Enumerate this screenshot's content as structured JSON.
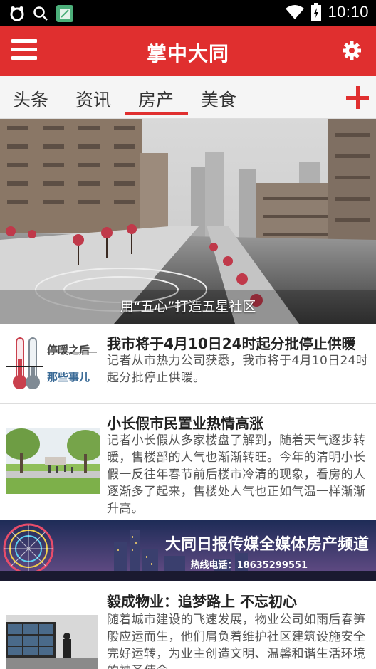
{
  "status_bar": {
    "time": "10:10"
  },
  "header": {
    "title": "掌中大同"
  },
  "tabs": [
    {
      "label": "头条"
    },
    {
      "label": "资讯"
    },
    {
      "label": "房产",
      "active": true
    },
    {
      "label": "美食"
    }
  ],
  "banner": {
    "caption": "用“五心”打造五星社区"
  },
  "news": [
    {
      "title": "我市将于4月10日24时起分批停止供暖",
      "desc": "记者从市热力公司获悉，我市将于4月10日24时起分批停止供暖。",
      "thumb_text_1": "停暖之后",
      "thumb_text_2": "那些事儿"
    },
    {
      "title": "小长假市民置业热情高涨",
      "desc": "记者小长假从多家楼盘了解到，随着天气逐步转暖，售楼部的人气也渐渐转旺。今年的清明小长假一反往年春节前后楼市冷清的现象，看房的人逐渐多了起来，售楼处人气也正如气温一样渐渐升高。"
    },
    {
      "title": "毅成物业：追梦路上 不忘初心",
      "desc": "随着城市建设的飞速发展，物业公司如雨后春笋般应运而生，他们肩负着维护社区建筑设施安全完好运转，为业主创造文明、温馨和谐生活环境的神圣使命"
    }
  ],
  "ad": {
    "title": "大同日报传媒全媒体房产频道",
    "hotline": "热线电话：18635299551"
  },
  "colors": {
    "accent": "#e02f2f",
    "statusbar": "#000000"
  }
}
